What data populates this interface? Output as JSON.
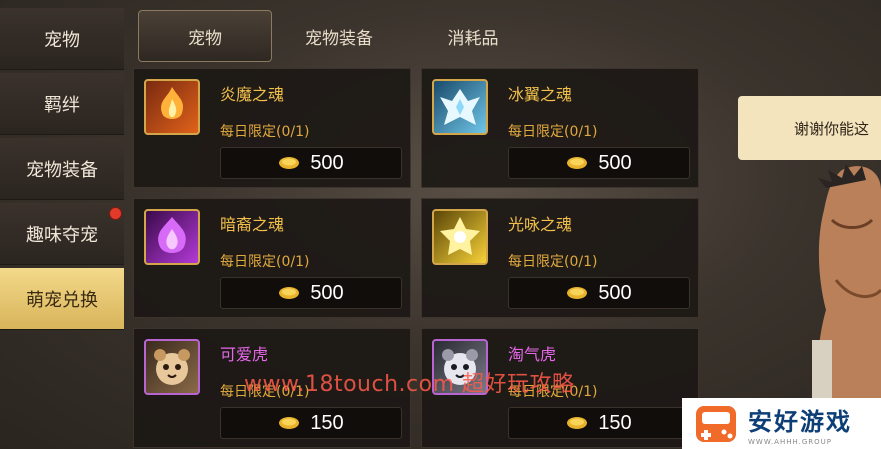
{
  "sidebar": {
    "items": [
      {
        "label": "宠物"
      },
      {
        "label": "羁绊"
      },
      {
        "label": "宠物装备"
      },
      {
        "label": "趣味夺宠"
      },
      {
        "label": "萌宠兑换"
      }
    ]
  },
  "tabs": [
    {
      "label": "宠物"
    },
    {
      "label": "宠物装备"
    },
    {
      "label": "消耗品"
    }
  ],
  "cards": [
    {
      "name": "炎魔之魂",
      "limit": "每日限定(0/1)",
      "price": "500"
    },
    {
      "name": "冰翼之魂",
      "limit": "每日限定(0/1)",
      "price": "500"
    },
    {
      "name": "暗裔之魂",
      "limit": "每日限定(0/1)",
      "price": "500"
    },
    {
      "name": "光咏之魂",
      "limit": "每日限定(0/1)",
      "price": "500"
    },
    {
      "name": "可爱虎",
      "limit": "每日限定(0/1)",
      "price": "150"
    },
    {
      "name": "淘气虎",
      "limit": "每日限定(0/1)",
      "price": "150"
    }
  ],
  "npc": {
    "speech": "谢谢你能这"
  },
  "watermark": {
    "text": "www.18touch.com 超好玩攻略"
  },
  "logo": {
    "name": "安好游戏",
    "sub": "WWW.AHHH.GROUP"
  },
  "colors": {
    "accent_gold": "#f1c04a",
    "accent_pink": "#e468e8",
    "active_tab": "#d8b45a",
    "notify_red": "#e23a2a"
  }
}
